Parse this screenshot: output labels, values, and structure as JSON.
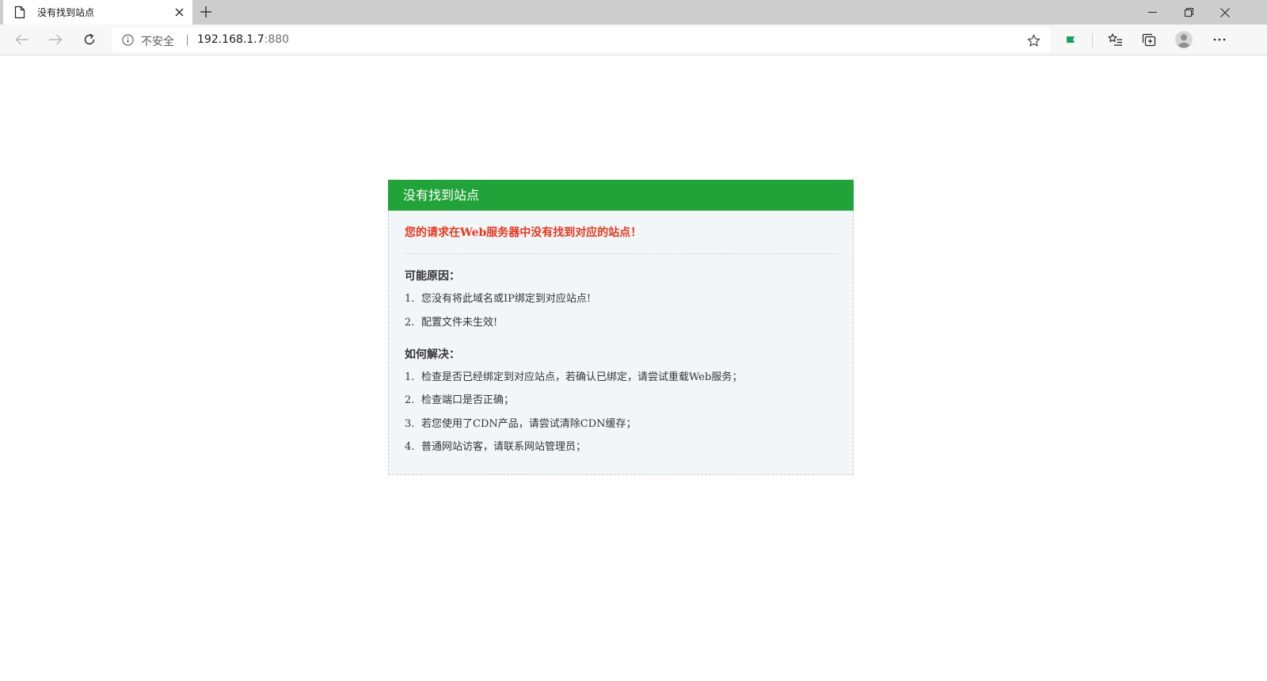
{
  "browser": {
    "tab": {
      "title": "没有找到站点"
    },
    "address_bar": {
      "security_label": "不安全",
      "url_host": "192.168.1.7",
      "url_port": ":880"
    }
  },
  "page": {
    "header_title": "没有找到站点",
    "error_message": "您的请求在Web服务器中没有找到对应的站点！",
    "reasons_title": "可能原因：",
    "reasons": [
      {
        "num": "1.",
        "text": "您没有将此域名或IP绑定到对应站点!"
      },
      {
        "num": "2.",
        "text": "配置文件未生效!"
      }
    ],
    "solutions_title": "如何解决：",
    "solutions": [
      {
        "num": "1.",
        "text": "检查是否已经绑定到对应站点，若确认已绑定，请尝试重载Web服务；"
      },
      {
        "num": "2.",
        "text": "检查端口是否正确；"
      },
      {
        "num": "3.",
        "text": "若您使用了CDN产品，请尝试清除CDN缓存；"
      },
      {
        "num": "4.",
        "text": "普通网站访客，请联系网站管理员；"
      }
    ]
  },
  "colors": {
    "header_green": "#22a33a",
    "error_red": "#e8361c",
    "panel_bg": "#f3f6f8",
    "extension_green": "#1aa260"
  }
}
